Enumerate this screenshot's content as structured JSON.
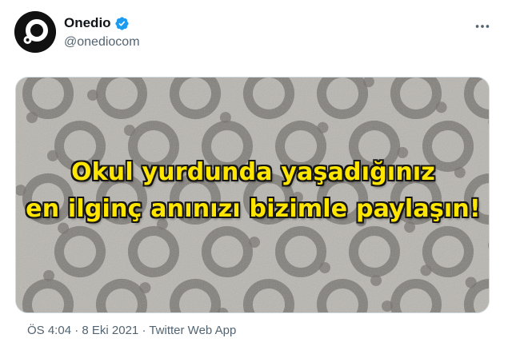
{
  "tweet": {
    "author": {
      "display_name": "Onedio",
      "handle": "@onediocom",
      "verified": true,
      "avatar_icon": "onedio-logo",
      "verified_icon": "verified-badge-icon",
      "verified_color": "#1d9bf0"
    },
    "more_icon": "more-options-icon",
    "media": {
      "headline_line1": "Okul yurdunda yaşadığınız",
      "headline_line2": "en ilginç anınızı bizimle paylaşın!",
      "headline_color": "#ffe600",
      "background_color": "#b8b4ae"
    },
    "meta": {
      "time": "ÖS 4:04",
      "separator": " · ",
      "date": "8 Eki 2021",
      "source": "Twitter Web App"
    }
  }
}
